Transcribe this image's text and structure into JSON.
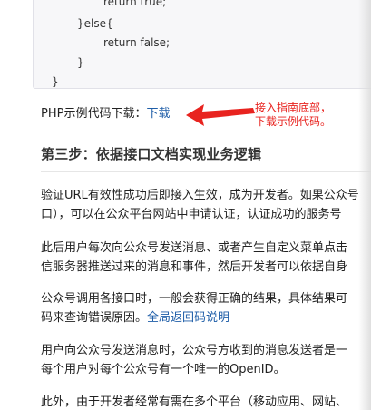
{
  "code": {
    "lines": [
      "return true;",
      "}else{",
      "return false;",
      "}",
      "}"
    ]
  },
  "download": {
    "label": "PHP示例代码下载：",
    "link": "下载"
  },
  "annotation": {
    "line1": "接入指南底部，",
    "line2": "下载示例代码。"
  },
  "heading": "第三步：依据接口文档实现业务逻辑",
  "paragraphs": [
    {
      "l1": "验证URL有效性成功后即接入生效，成为开发者。如果公众号",
      "l2": "口），可以在公众平台网站中申请认证，认证成功的服务号"
    },
    {
      "l1": "此后用户每次向公众号发送消息、或者产生自定义菜单点击",
      "l2": "信服务器推送过来的消息和事件，然后开发者可以依据自身"
    },
    {
      "l1": "公众号调用各接口时，一般会获得正确的结果，具体结果可",
      "l2_text": "码来查询错误原因。",
      "l2_link": "全局返回码说明"
    },
    {
      "l1": "用户向公众号发送消息时，公众号方收到的消息发送者是一",
      "l2": "每个用户对每个公众号有一个唯一的OpenID。"
    },
    {
      "l1": "此外，由于开发者经常有需在多个平台（移动应用、网站、"
    }
  ]
}
